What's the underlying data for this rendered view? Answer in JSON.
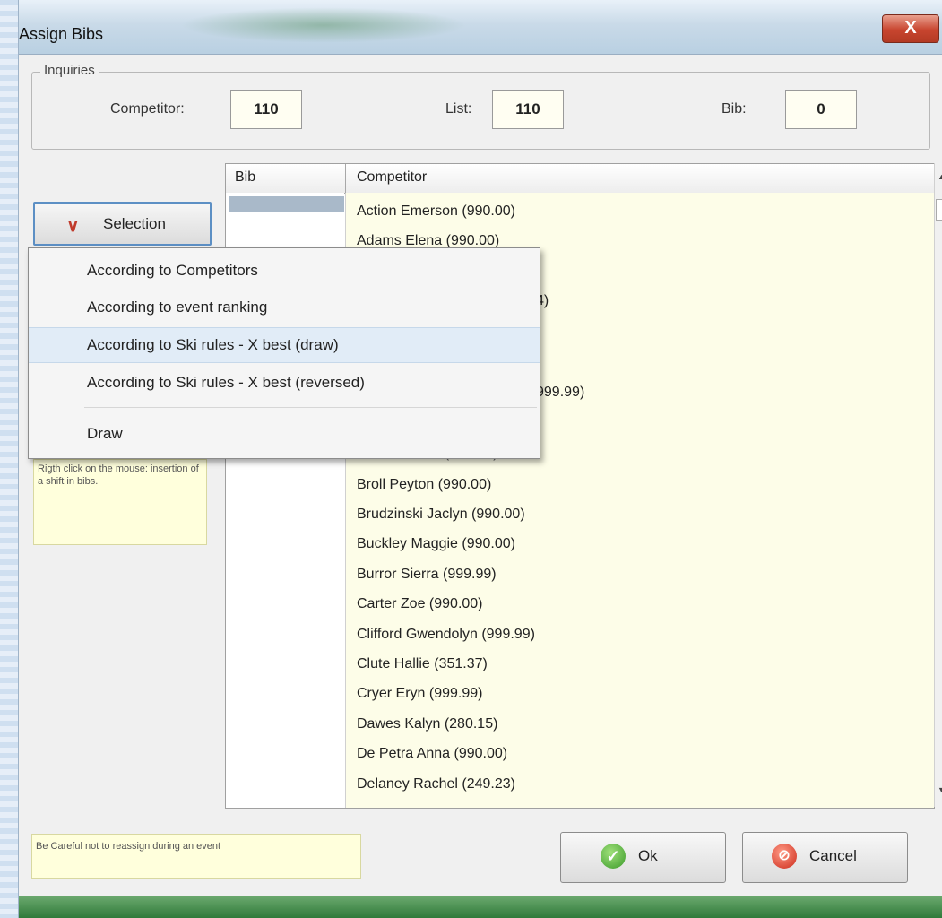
{
  "window": {
    "title": "Assign Bibs",
    "close_label": "X"
  },
  "inquiries": {
    "legend": "Inquiries",
    "competitor_label": "Competitor:",
    "competitor_value": "110",
    "list_label": "List:",
    "list_value": "110",
    "bib_label": "Bib:",
    "bib_value": "0"
  },
  "selection_button": {
    "label": "Selection",
    "icon": "chevron-down-icon"
  },
  "grid": {
    "columns": [
      "Bib",
      "Competitor"
    ],
    "rows": [
      "Action Emerson (990.00)",
      "Adams Elena (990.00)",
      "",
      "",
      "",
      "",
      "",
      "",
      "",
      "Broll Peyton (990.00)",
      "Brudzinski Jaclyn (990.00)",
      "Buckley Maggie (990.00)",
      "Burror Sierra (999.99)",
      "Carter Zoe (990.00)",
      "Clifford Gwendolyn (999.99)",
      "Clute Hallie (351.37)",
      "Cryer Eryn (999.99)",
      "Dawes Kalyn (280.15)",
      "De Petra Anna (990.00)",
      "Delaney Rachel (249.23)"
    ],
    "partial_fragments": [
      "4)",
      ")",
      "999.99)",
      "Bouchar Nori (990.00)"
    ]
  },
  "selection_menu": {
    "items": [
      "According to Competitors",
      "According to event ranking",
      "According to Ski rules - X best (draw)",
      "According to Ski rules - X best (reversed)",
      "Draw"
    ],
    "highlighted_index": 2
  },
  "notes": {
    "right_click": "Rigth click on the mouse: insertion of a shift in bibs.",
    "warning": "Be Careful not to reassign during an event"
  },
  "buttons": {
    "ok": "Ok",
    "cancel": "Cancel"
  },
  "colors": {
    "menu_highlight": "#e1ecf7",
    "grid_competitor_bg": "#fdfde8",
    "note_bg": "#ffffdc"
  }
}
